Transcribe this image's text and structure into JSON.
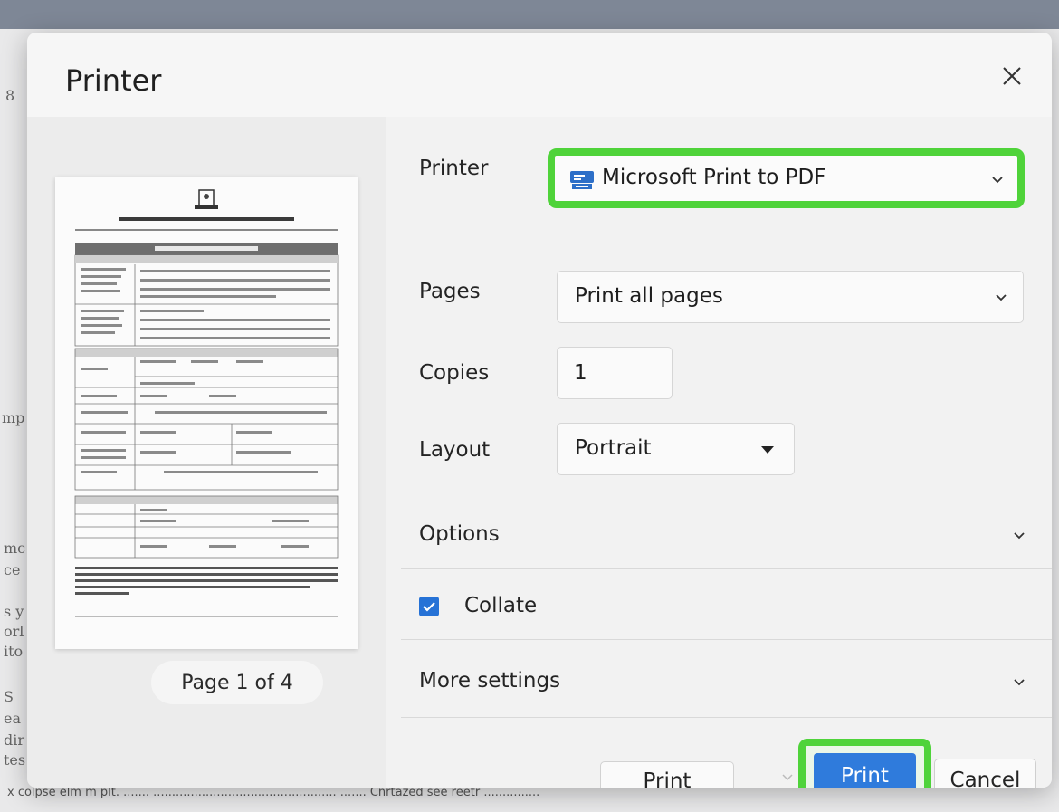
{
  "background": {
    "fragments": [
      "8",
      "mp",
      "mc",
      "ce",
      "s y",
      "orl",
      "ito",
      "S",
      "ea",
      "dir",
      "tes"
    ],
    "bottom_line": "x colpse  elm m plt.  ....... ................................................. .......        Cnrtazed see reetr ..............."
  },
  "dialog": {
    "title": "Printer",
    "preview": {
      "page_indicator": "Page 1 of 4"
    },
    "settings": {
      "printer_label": "Printer",
      "printer_value": "Microsoft Print to PDF",
      "pages_label": "Pages",
      "pages_value": "Print all pages",
      "copies_label": "Copies",
      "copies_value": "1",
      "layout_label": "Layout",
      "layout_value": "Portrait",
      "options_label": "Options",
      "collate_label": "Collate",
      "collate_checked": true,
      "more_settings_label": "More settings"
    },
    "buttons": {
      "print_secondary": "Print",
      "print_primary": "Print",
      "cancel": "Cancel"
    }
  },
  "colors": {
    "accent": "#2f7bdc",
    "highlight": "#4fd33a"
  }
}
